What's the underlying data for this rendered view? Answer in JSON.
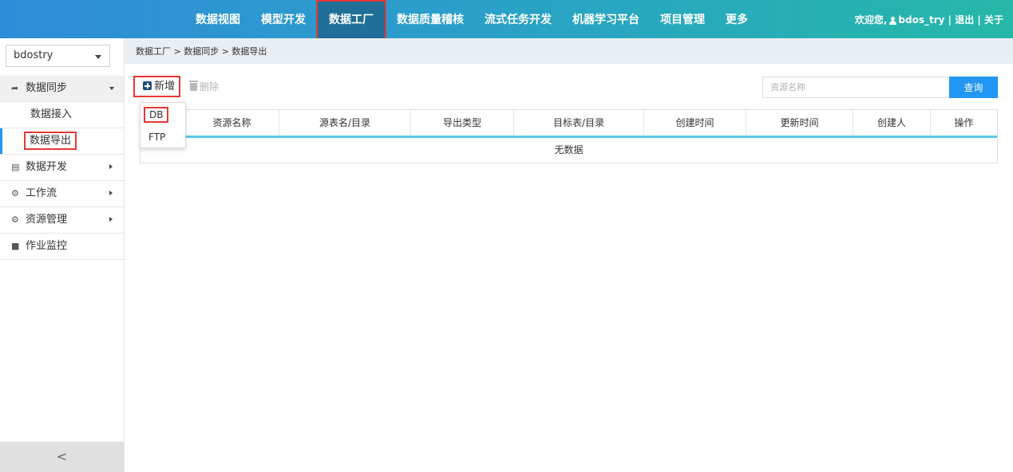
{
  "nav": {
    "items": [
      {
        "label": "数据视图",
        "active": false
      },
      {
        "label": "模型开发",
        "active": false
      },
      {
        "label": "数据工厂",
        "active": true
      },
      {
        "label": "数据质量稽核",
        "active": false
      },
      {
        "label": "流式任务开发",
        "active": false
      },
      {
        "label": "机器学习平台",
        "active": false
      },
      {
        "label": "项目管理",
        "active": false
      },
      {
        "label": "更多",
        "active": false
      }
    ]
  },
  "user": {
    "welcome": "欢迎您,",
    "username": "bdos_try",
    "sep1": " | ",
    "logout": "退出",
    "sep2": " | ",
    "about": "关于"
  },
  "sidebar": {
    "project": "bdostry",
    "menu": {
      "sync": {
        "label": "数据同步",
        "icon": "share-arrow-icon"
      },
      "sync_import": {
        "label": "数据接入"
      },
      "sync_export": {
        "label": "数据导出"
      },
      "dev": {
        "label": "数据开发",
        "icon": "document-icon"
      },
      "workflow": {
        "label": "工作流",
        "icon": "gears-icon"
      },
      "resource": {
        "label": "资源管理",
        "icon": "gear-icon"
      },
      "monitor": {
        "label": "作业监控",
        "icon": "book-icon"
      }
    },
    "collapse": "<"
  },
  "breadcrumb": "数据工厂 > 数据同步 > 数据导出",
  "toolbar": {
    "add_label": "新增",
    "delete_label": "删除"
  },
  "dropdown": {
    "db": "DB",
    "ftp": "FTP"
  },
  "search": {
    "placeholder": "资源名称",
    "button": "查询"
  },
  "table": {
    "columns": [
      "",
      "资源名称",
      "源表名/目录",
      "导出类型",
      "目标表/目录",
      "创建时间",
      "更新时间",
      "创建人",
      "操作"
    ],
    "empty": "无数据"
  },
  "colors": {
    "accent": "#2196f3",
    "highlight": "#e53935",
    "table_header_line": "#5bcbe6"
  }
}
